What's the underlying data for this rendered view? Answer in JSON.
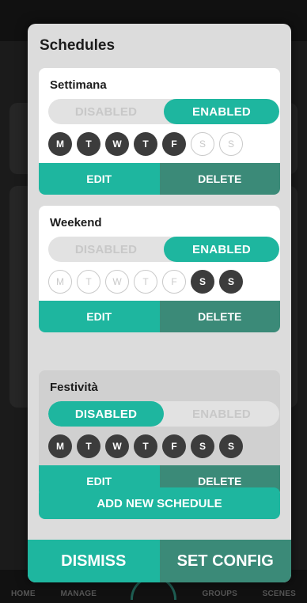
{
  "modal": {
    "title": "Schedules",
    "add_label": "ADD NEW SCHEDULE",
    "dismiss_label": "DISMISS",
    "set_config_label": "SET CONFIG"
  },
  "toggle_labels": {
    "disabled": "DISABLED",
    "enabled": "ENABLED"
  },
  "actions": {
    "edit": "EDIT",
    "delete": "DELETE"
  },
  "day_letters": [
    "M",
    "T",
    "W",
    "T",
    "F",
    "S",
    "S"
  ],
  "schedules": [
    {
      "name": "Settimana",
      "enabled": true,
      "days_active": [
        true,
        true,
        true,
        true,
        true,
        false,
        false
      ]
    },
    {
      "name": "Weekend",
      "enabled": true,
      "days_active": [
        false,
        false,
        false,
        false,
        false,
        true,
        true
      ]
    },
    {
      "name": "Festività",
      "enabled": false,
      "days_active": [
        true,
        true,
        true,
        true,
        true,
        true,
        true
      ]
    }
  ],
  "background_nav": {
    "items": [
      "HOME",
      "MANAGE",
      "GROUPS",
      "SCENES"
    ]
  },
  "colors": {
    "accent": "#1eb69f",
    "accent_dark": "#3b8a78",
    "day_active": "#3c3c3c"
  }
}
